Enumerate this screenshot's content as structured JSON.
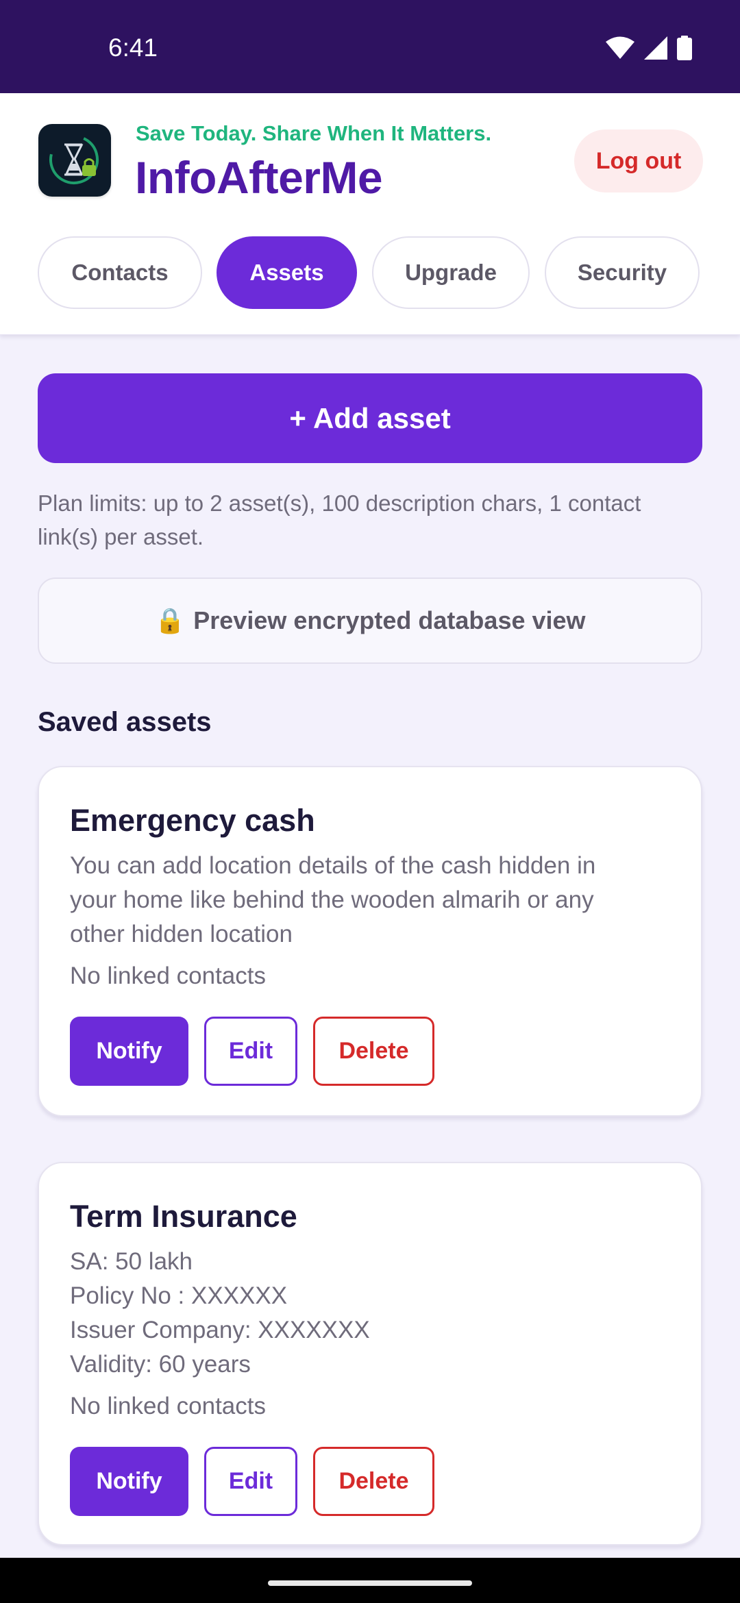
{
  "status_bar": {
    "time": "6:41",
    "icons": [
      "wifi-icon",
      "signal-icon",
      "battery-icon"
    ]
  },
  "header": {
    "logo_icon": "hourglass-lock-icon",
    "tagline": "Save Today. Share When It Matters.",
    "title": "InfoAfterMe",
    "logout_label": "Log out"
  },
  "tabs": [
    {
      "label": "Contacts",
      "active": false
    },
    {
      "label": "Assets",
      "active": true
    },
    {
      "label": "Upgrade",
      "active": false
    },
    {
      "label": "Security",
      "active": false
    }
  ],
  "main": {
    "add_asset_label": "+ Add asset",
    "plan_limits": "Plan limits: up to 2 asset(s), 100 description chars, 1 contact link(s) per asset.",
    "preview_icon": "lock-icon",
    "preview_glyph": "🔒",
    "preview_label": "Preview encrypted database view",
    "saved_title": "Saved assets"
  },
  "assets": [
    {
      "title": "Emergency cash",
      "description_lines": [
        "You can add location details of the cash hidden in",
        "your home like behind the wooden almarih or any",
        "other hidden location"
      ],
      "linked": "No linked contacts",
      "notify_label": "Notify",
      "edit_label": "Edit",
      "delete_label": "Delete"
    },
    {
      "title": "Term Insurance",
      "description_lines": [
        "SA: 50 lakh",
        "Policy No : XXXXXX",
        "Issuer Company: XXXXXXX",
        "Validity: 60 years"
      ],
      "linked": "No linked contacts",
      "notify_label": "Notify",
      "edit_label": "Edit",
      "delete_label": "Delete"
    }
  ],
  "colors": {
    "status_bar": "#2e1260",
    "brand_purple": "#6c2bd9",
    "title_purple": "#4f1aa6",
    "tagline_green": "#1fb57e",
    "danger_red": "#d52a2a",
    "page_background": "#f3f1fc"
  }
}
